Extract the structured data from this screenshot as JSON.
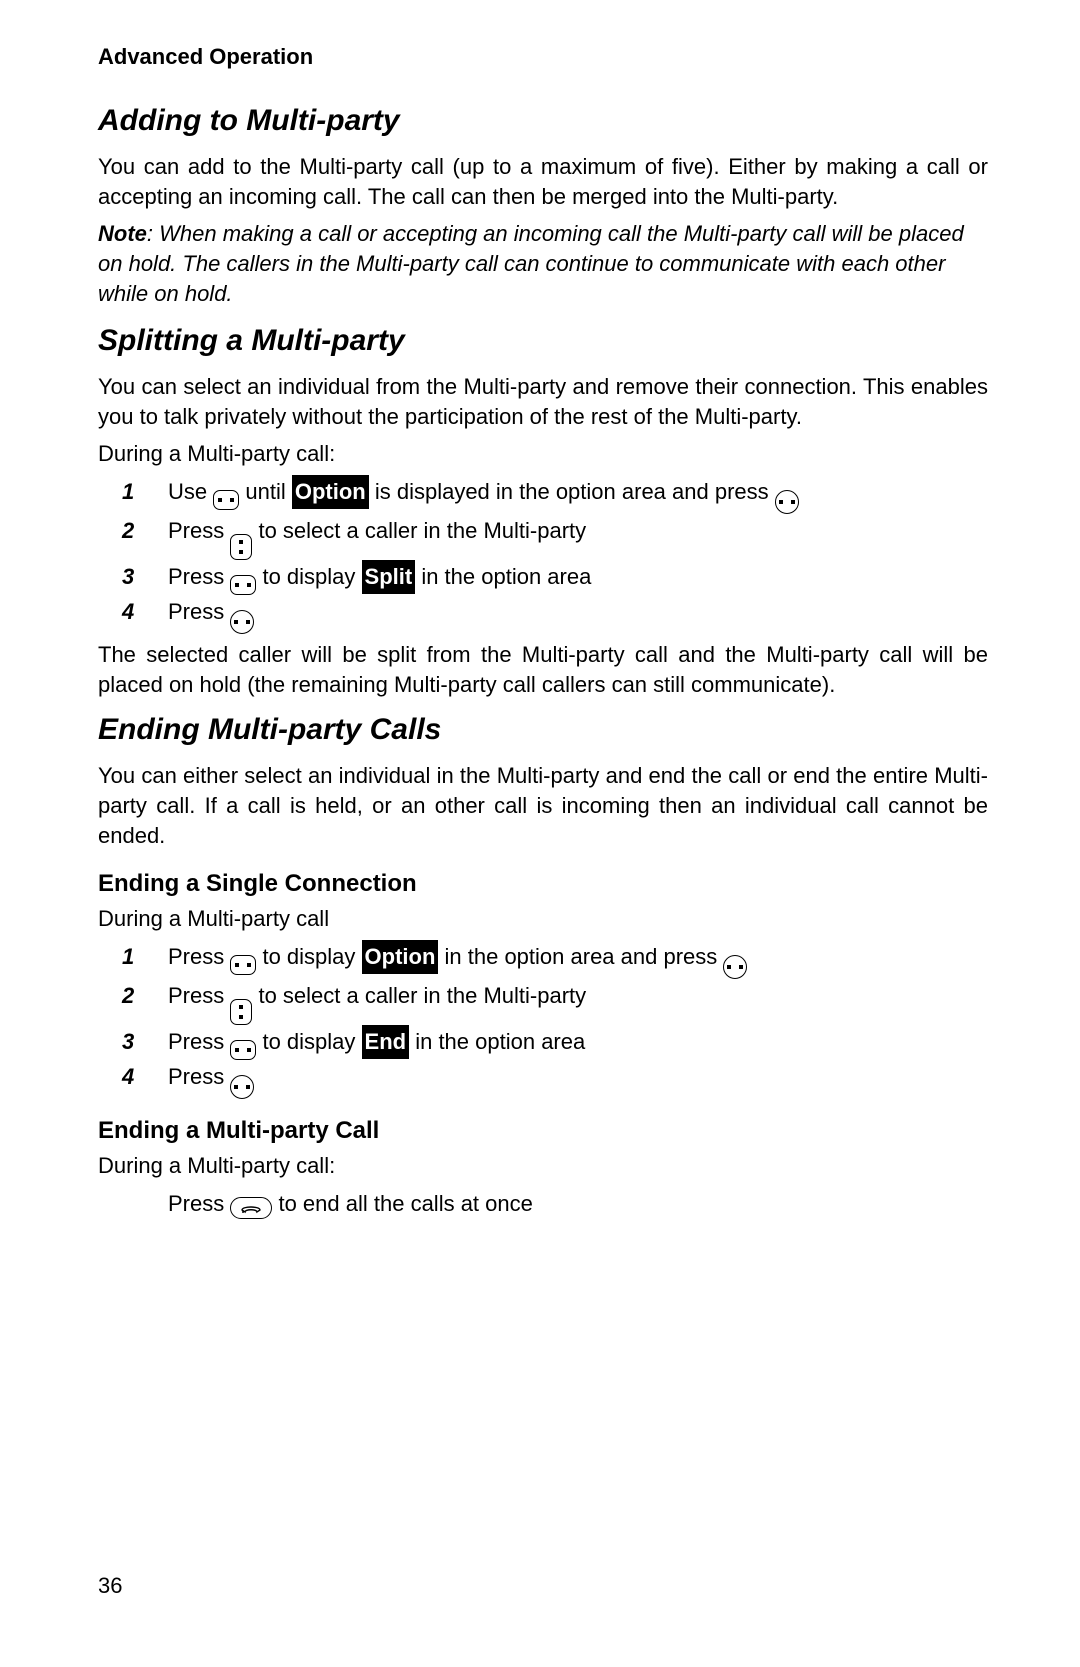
{
  "running_header": "Advanced Operation",
  "page_number": "36",
  "inv": {
    "option": "Option",
    "split": "Split",
    "end": "End"
  },
  "s1": {
    "heading": "Adding to Multi-party",
    "para": "You can add to the Multi-party call (up to a maximum of five). Either by making a call or accepting an incoming call. The call can then be merged into the Multi-party.",
    "note_label": "Note",
    "note": ": When making a call or accepting an incoming call the Multi-party call will be placed on hold. The callers in the Multi-party call can continue to communicate with each other while on hold."
  },
  "s2": {
    "heading": "Splitting a Multi-party",
    "para1": "You can select an individual from the Multi-party and remove their connection. This enables you to talk privately without the participation of the rest of the Multi-party.",
    "lead": "During a Multi-party call:",
    "step1a": "Use ",
    "step1b": " until ",
    "step1c": " is displayed in the option area and press ",
    "step2a": "Press ",
    "step2b": " to select a caller in the Multi-party",
    "step3a": "Press ",
    "step3b": " to display ",
    "step3c": " in the option area",
    "step4a": "Press ",
    "after": "The selected caller will be split from the Multi-party call and the Multi-party call will be placed on hold (the remaining Multi-party call callers can still communicate)."
  },
  "s3": {
    "heading": "Ending Multi-party Calls",
    "para": "You can either select an individual in the Multi-party and end the call or end the entire Multi-party call. If a call is held, or an other call is incoming then an individual call cannot be ended.",
    "sub1": {
      "heading": "Ending a Single Connection",
      "lead": "During a Multi-party call",
      "step1a": "Press ",
      "step1b": " to display ",
      "step1c": " in the option area and press ",
      "step2a": "Press ",
      "step2b": " to select a caller in the Multi-party",
      "step3a": "Press ",
      "step3b": " to display ",
      "step3c": " in the option area",
      "step4a": "Press "
    },
    "sub2": {
      "heading": "Ending a Multi-party Call",
      "lead": "During a Multi-party call:",
      "step_a": "Press ",
      "step_b": " to end all the calls at once"
    }
  },
  "nums": {
    "n1": "1",
    "n2": "2",
    "n3": "3",
    "n4": "4"
  }
}
